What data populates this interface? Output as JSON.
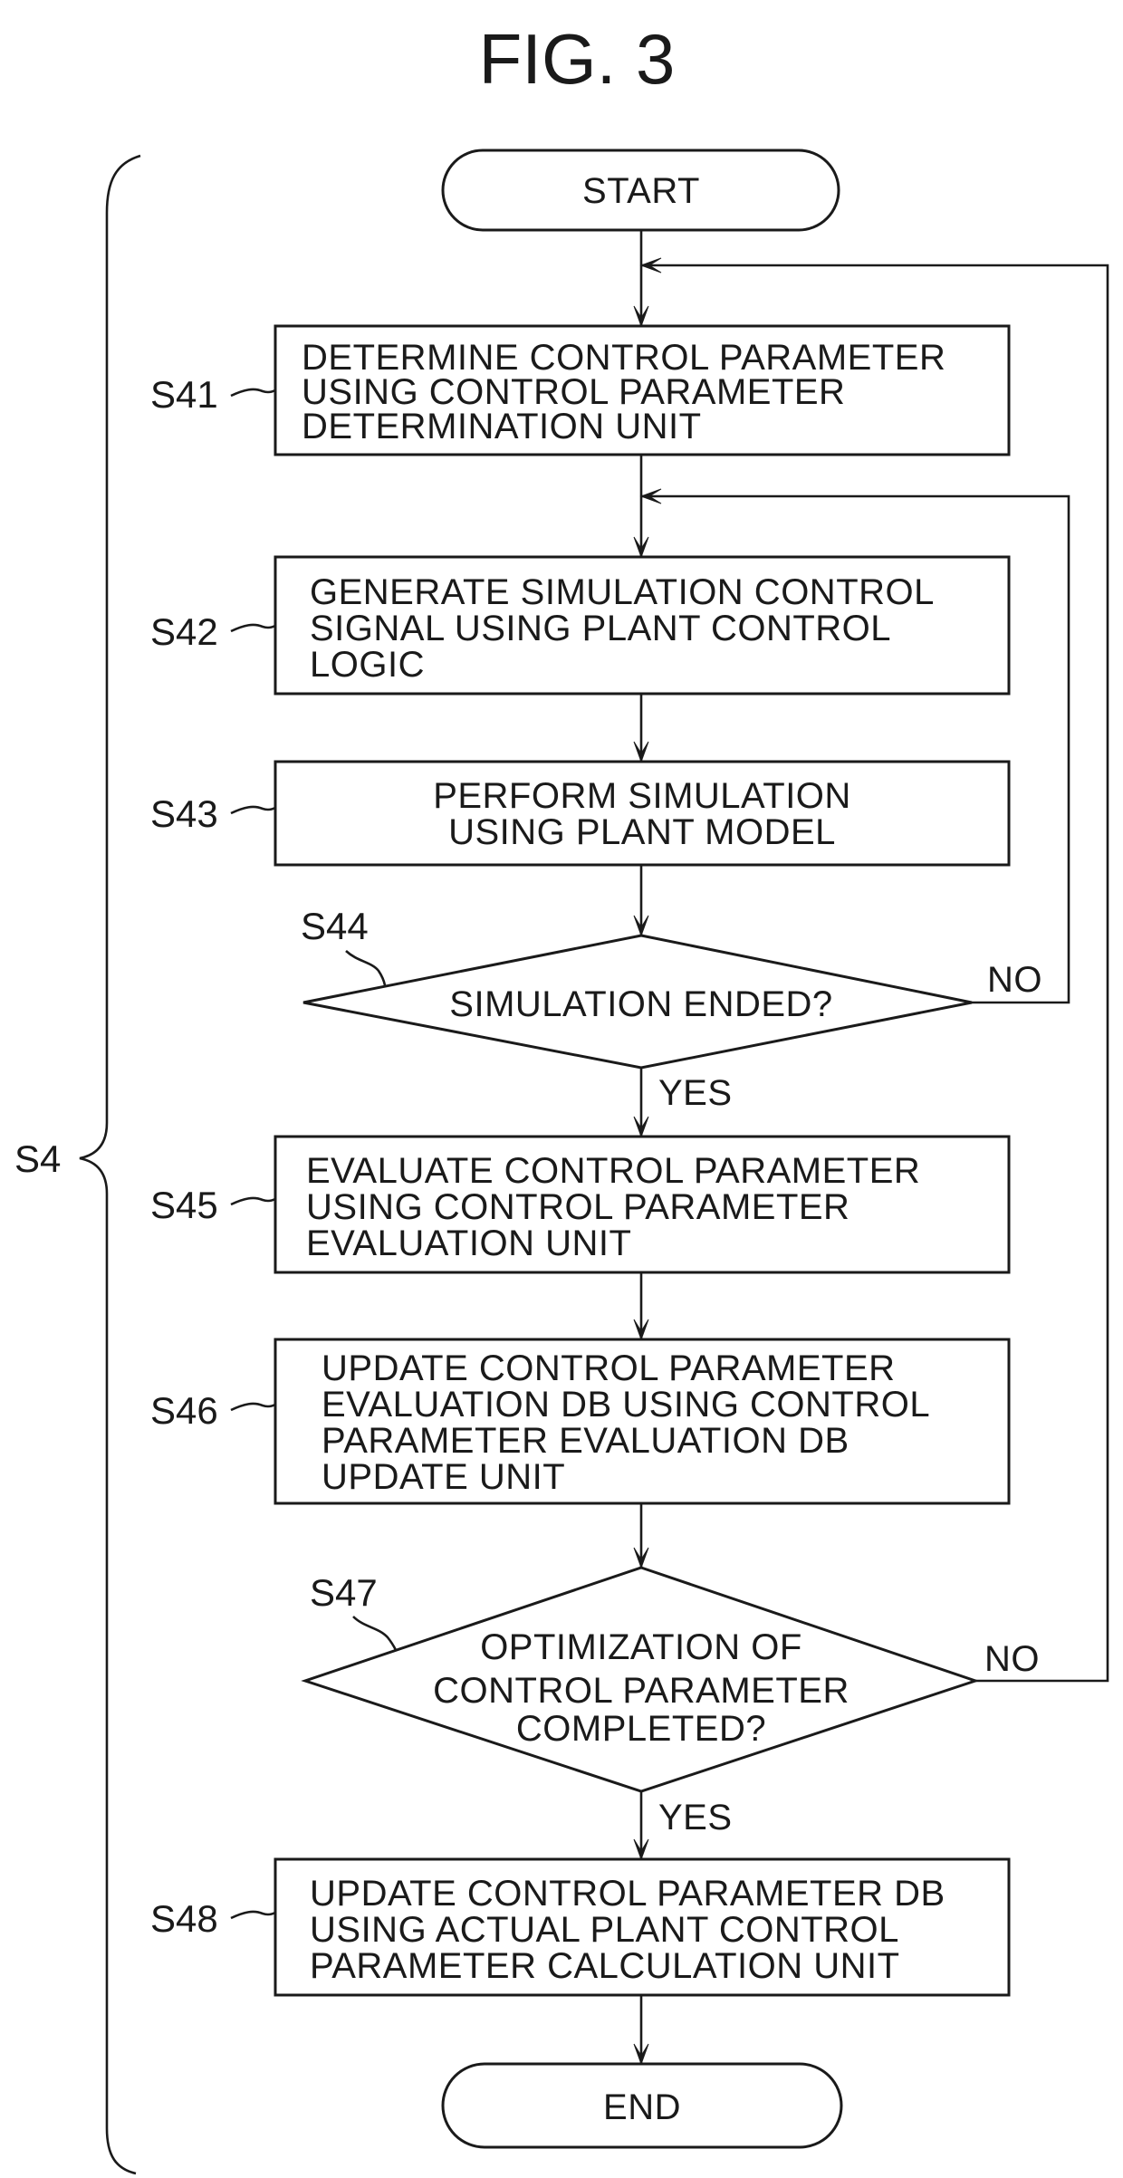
{
  "figure": {
    "title": "FIG. 3",
    "group_label": "S4"
  },
  "terminals": {
    "start": "START",
    "end": "END"
  },
  "steps": [
    {
      "id": "S41",
      "type": "process",
      "lines": [
        "DETERMINE CONTROL PARAMETER",
        "USING CONTROL PARAMETER",
        "DETERMINATION UNIT"
      ]
    },
    {
      "id": "S42",
      "type": "process",
      "lines": [
        "GENERATE SIMULATION CONTROL",
        "SIGNAL USING PLANT CONTROL",
        "LOGIC"
      ]
    },
    {
      "id": "S43",
      "type": "process",
      "lines": [
        "PERFORM SIMULATION",
        "USING PLANT MODEL"
      ]
    },
    {
      "id": "S44",
      "type": "decision",
      "lines": [
        "SIMULATION ENDED?"
      ],
      "yes": "YES",
      "no": "NO"
    },
    {
      "id": "S45",
      "type": "process",
      "lines": [
        "EVALUATE CONTROL PARAMETER",
        "USING CONTROL PARAMETER",
        "EVALUATION UNIT"
      ]
    },
    {
      "id": "S46",
      "type": "process",
      "lines": [
        "UPDATE CONTROL PARAMETER",
        "EVALUATION DB USING CONTROL",
        "PARAMETER EVALUATION DB",
        "UPDATE UNIT"
      ]
    },
    {
      "id": "S47",
      "type": "decision",
      "lines": [
        "OPTIMIZATION OF",
        "CONTROL PARAMETER",
        "COMPLETED?"
      ],
      "yes": "YES",
      "no": "NO"
    },
    {
      "id": "S48",
      "type": "process",
      "lines": [
        "UPDATE CONTROL PARAMETER DB",
        "USING ACTUAL PLANT CONTROL",
        "PARAMETER CALCULATION UNIT"
      ]
    }
  ],
  "flow": {
    "S44_no_target": "S42",
    "S47_no_target": "S41"
  }
}
